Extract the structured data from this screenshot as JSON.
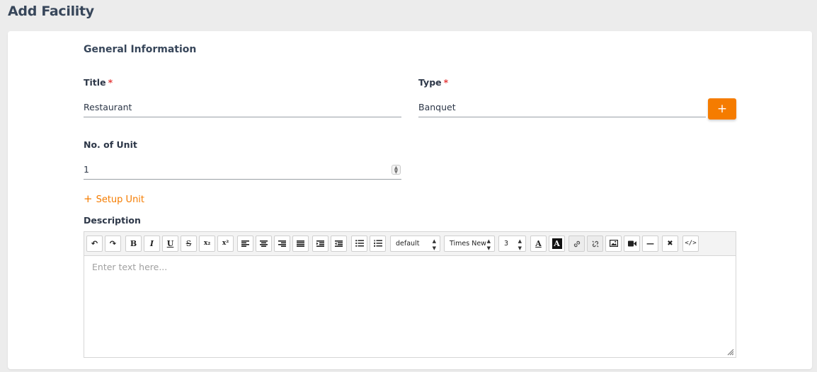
{
  "page": {
    "title": "Add Facility"
  },
  "form": {
    "section_title": "General Information",
    "title_field": {
      "label": "Title",
      "required_mark": "*",
      "value": "Restaurant"
    },
    "type_field": {
      "label": "Type",
      "required_mark": "*",
      "value": "Banquet",
      "add_button_label": "+"
    },
    "units_field": {
      "label": "No. of Unit",
      "value": "1"
    },
    "setup_unit": {
      "icon": "+",
      "label": "Setup Unit"
    },
    "description": {
      "label": "Description",
      "placeholder": "Enter text here..."
    }
  },
  "toolbar": {
    "undo": "↶",
    "redo": "↷",
    "bold": "B",
    "italic": "I",
    "underline": "U",
    "strikethrough": "S",
    "subscript": "x₂",
    "superscript": "x²",
    "font_format": "default",
    "font_family": "Times New",
    "font_size": "3",
    "text_color": "A",
    "bg_color": "A",
    "hr": "—",
    "remove_format": "✖",
    "source": "</>"
  },
  "colors": {
    "accent": "#f57c00",
    "required": "#e53e3e",
    "title": "#37465a"
  },
  "icons": [
    "undo-icon",
    "redo-icon",
    "align-left-icon",
    "align-center-icon",
    "align-right-icon",
    "justify-icon",
    "indent-icon",
    "outdent-icon",
    "bullet-list-icon",
    "numbered-list-icon",
    "link-icon",
    "unlink-icon",
    "image-icon",
    "video-icon",
    "source-icon"
  ]
}
